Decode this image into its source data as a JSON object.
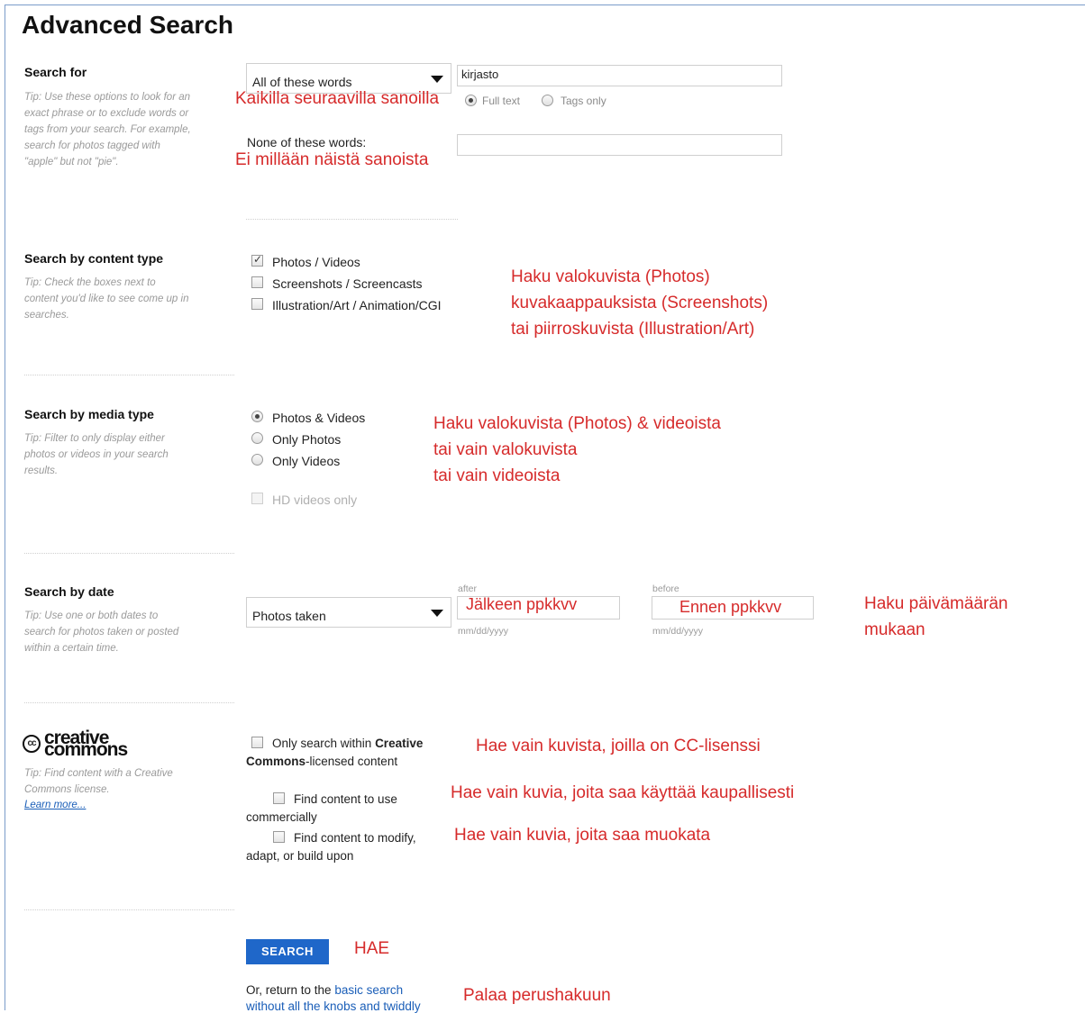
{
  "page": {
    "title": "Advanced Search"
  },
  "search_for": {
    "title": "Search for",
    "tip_prefix": "Tip:",
    "tip": "Use these options to look for an exact phrase or to exclude words or tags from your search. For example, search for photos tagged with \"apple\" but not \"pie\".",
    "mode_select": "All of these words",
    "query_value": "kirjasto",
    "radio_full_text": "Full text",
    "radio_tags_only": "Tags only",
    "none_label": "None of these words:",
    "none_value": "",
    "annot_all": "Kaikilla seuraavilla sanoilla",
    "annot_none": "Ei millään näistä sanoista"
  },
  "content_type": {
    "title": "Search by content type",
    "tip_prefix": "Tip:",
    "tip": "Check the boxes next to content you'd like to see come up in searches.",
    "options": [
      {
        "label": "Photos / Videos",
        "checked": true
      },
      {
        "label": "Screenshots / Screencasts",
        "checked": false
      },
      {
        "label": "Illustration/Art / Animation/CGI",
        "checked": false
      }
    ],
    "annot": [
      "Haku valokuvista (Photos)",
      "kuvakaappauksista (Screenshots)",
      "tai piirroskuvista (Illustration/Art)"
    ]
  },
  "media_type": {
    "title": "Search by media type",
    "tip_prefix": "Tip:",
    "tip": "Filter to only display either photos or videos in your search results.",
    "options": [
      {
        "label": "Photos & Videos",
        "selected": true
      },
      {
        "label": "Only Photos",
        "selected": false
      },
      {
        "label": "Only Videos",
        "selected": false
      }
    ],
    "hd_label": "HD videos only",
    "annot": [
      "Haku valokuvista (Photos) & videoista",
      "tai vain valokuvista",
      "tai vain videoista"
    ]
  },
  "date": {
    "title": "Search by date",
    "tip_prefix": "Tip:",
    "tip": "Use one or both dates to search for photos taken or posted within a certain time.",
    "select": "Photos taken",
    "after_label": "after",
    "before_label": "before",
    "after_value": "Jälkeen ppkkvv",
    "before_value": "Ennen ppkkvv",
    "format_hint": "mm/dd/yyyy",
    "annot": [
      "Haku päivämäärän",
      "mukaan"
    ]
  },
  "cc": {
    "logo_mark": "cc",
    "logo_line1": "creative",
    "logo_line2": "commons",
    "tip_prefix": "Tip:",
    "tip": "Find content with a Creative Commons license.",
    "learn_more": "Learn more...",
    "only_cc_a": "Only search within",
    "only_cc_b": "Creative",
    "only_cc_c": "Commons",
    "only_cc_d": "-licensed content",
    "commercial_a": "Find content to use",
    "commercial_b": "commercially",
    "modify_a": "Find content to modify,",
    "modify_b": "adapt, or build upon",
    "annot_cc": "Hae vain kuvista, joilla on CC-lisenssi",
    "annot_commercial": "Hae vain kuvia, joita saa käyttää kaupallisesti",
    "annot_modify": "Hae vain kuvia, joita saa muokata"
  },
  "footer": {
    "search_button": "SEARCH",
    "annot_search": "HAE",
    "return_a": "Or, return to the",
    "return_link_a": "basic search",
    "return_link_b": "without all the knobs and twiddly",
    "annot_return": "Palaa perushakuun"
  },
  "colors": {
    "annotation": "#d62b2b",
    "button": "#1f67c9",
    "link": "#1a5eb8"
  }
}
